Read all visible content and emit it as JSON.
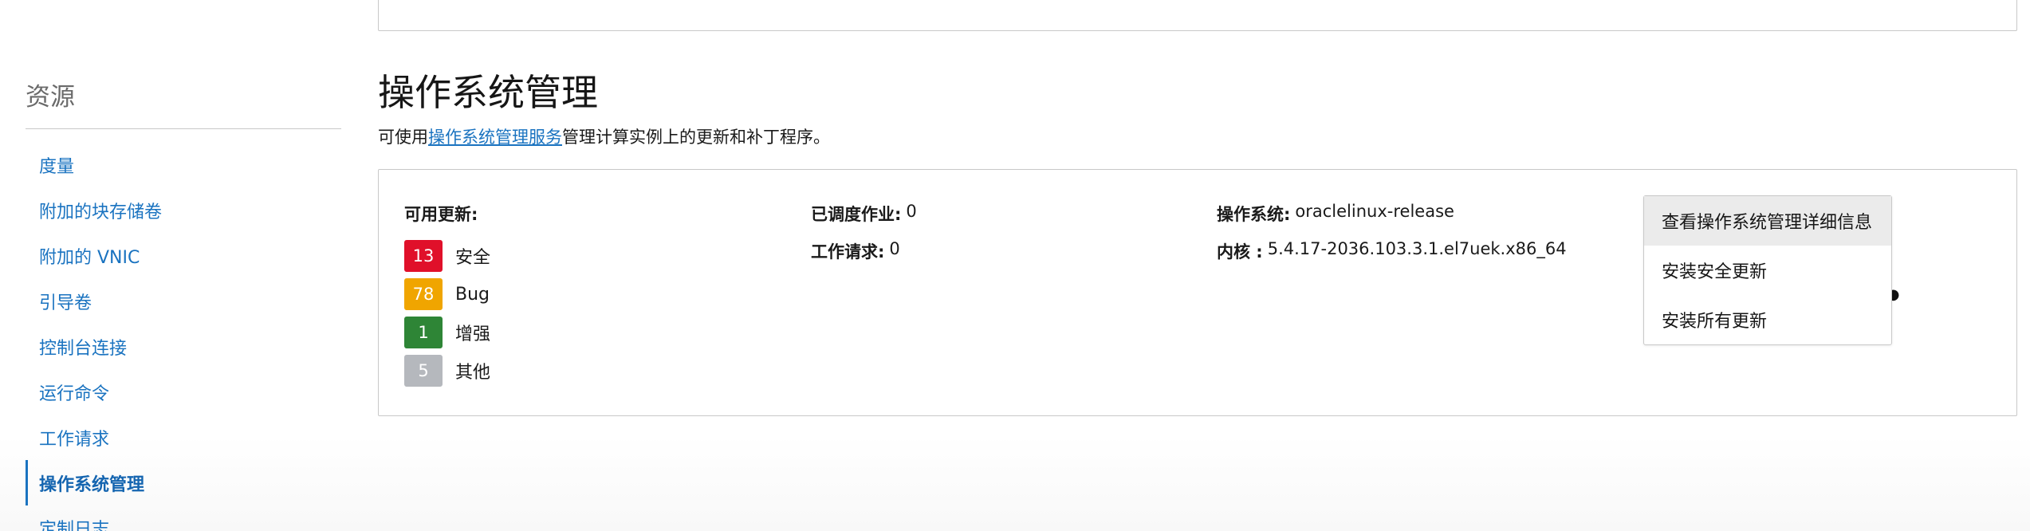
{
  "sidebar": {
    "title": "资源",
    "items": [
      {
        "label": "度量"
      },
      {
        "label": "附加的块存储卷"
      },
      {
        "label": "附加的 VNIC"
      },
      {
        "label": "引导卷"
      },
      {
        "label": "控制台连接"
      },
      {
        "label": "运行命令"
      },
      {
        "label": "工作请求"
      },
      {
        "label": "操作系统管理"
      },
      {
        "label": "定制日志"
      }
    ],
    "active_item": "操作系统管理"
  },
  "main": {
    "title": "操作系统管理",
    "desc_prefix": "可使用",
    "desc_link": "操作系统管理服务",
    "desc_suffix": "管理计算实例上的更新和补丁程序。"
  },
  "card": {
    "updates_title": "可用更新:",
    "updates": [
      {
        "count": "13",
        "label": "安全",
        "color": "#e0102a"
      },
      {
        "count": "78",
        "label": "Bug",
        "color": "#f0a500"
      },
      {
        "count": "1",
        "label": "增强",
        "color": "#2e8536"
      },
      {
        "count": "5",
        "label": "其他",
        "color": "#b5b8bd"
      }
    ],
    "scheduled_jobs_label": "已调度作业:",
    "scheduled_jobs_value": "0",
    "work_requests_label": "工作请求:",
    "work_requests_value": "0",
    "os_label": "操作系统:",
    "os_value": "oraclelinux-release",
    "kernel_label": "内核 :",
    "kernel_value": "5.4.17-2036.103.3.1.el7uek.x86_64"
  },
  "menu": {
    "items": [
      {
        "label": "查看操作系统管理详细信息"
      },
      {
        "label": "安装安全更新"
      },
      {
        "label": "安装所有更新"
      }
    ]
  },
  "kebab": {
    "glyph": "●●"
  }
}
